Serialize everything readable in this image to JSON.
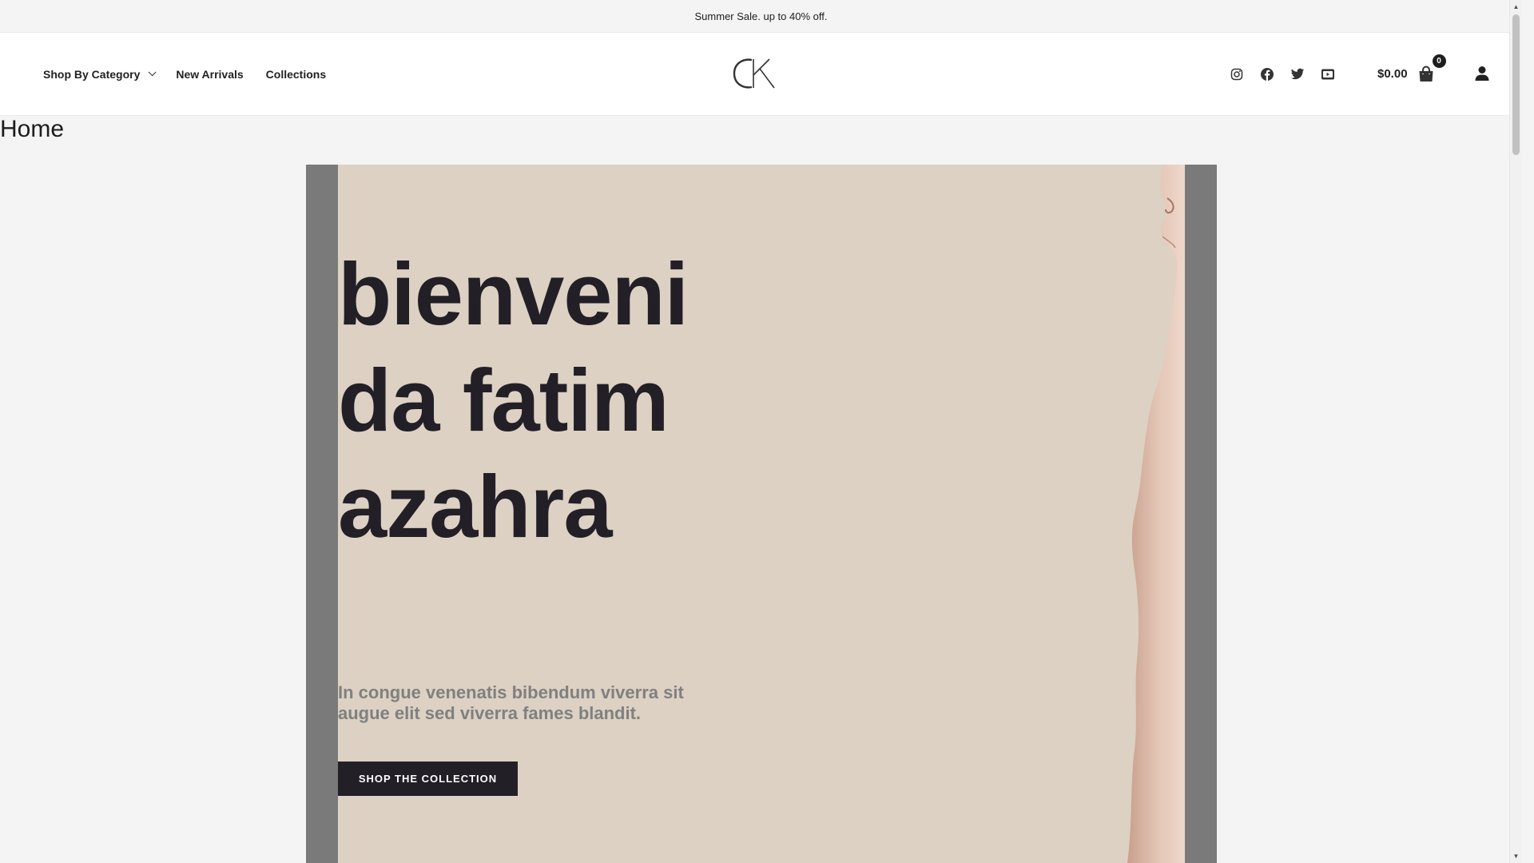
{
  "announcement": {
    "text": "Summer Sale. up to 40% off."
  },
  "header": {
    "nav": [
      {
        "label": "Shop By Category",
        "has_dropdown": true
      },
      {
        "label": "New Arrivals"
      },
      {
        "label": "Collections"
      }
    ],
    "logo_text": "CK",
    "social_icons": [
      "instagram-icon",
      "facebook-icon",
      "twitter-icon",
      "youtube-icon"
    ],
    "cart": {
      "total": "$0.00",
      "count": "0",
      "icon": "shopping-bag-icon"
    },
    "account_icon": "user-icon"
  },
  "page": {
    "title": "Home"
  },
  "hero": {
    "heading": "bienvenida fatimazahra",
    "subtitle": "In congue venenatis bibendum viverra sit augue elit sed viverra fames blandit.",
    "cta_label": "SHOP THE COLLECTION",
    "colors": {
      "frame": "#7a7a7a",
      "background": "#dcd1c3",
      "heading": "#221f27",
      "subtitle": "#808080",
      "button": "#221f27"
    }
  }
}
